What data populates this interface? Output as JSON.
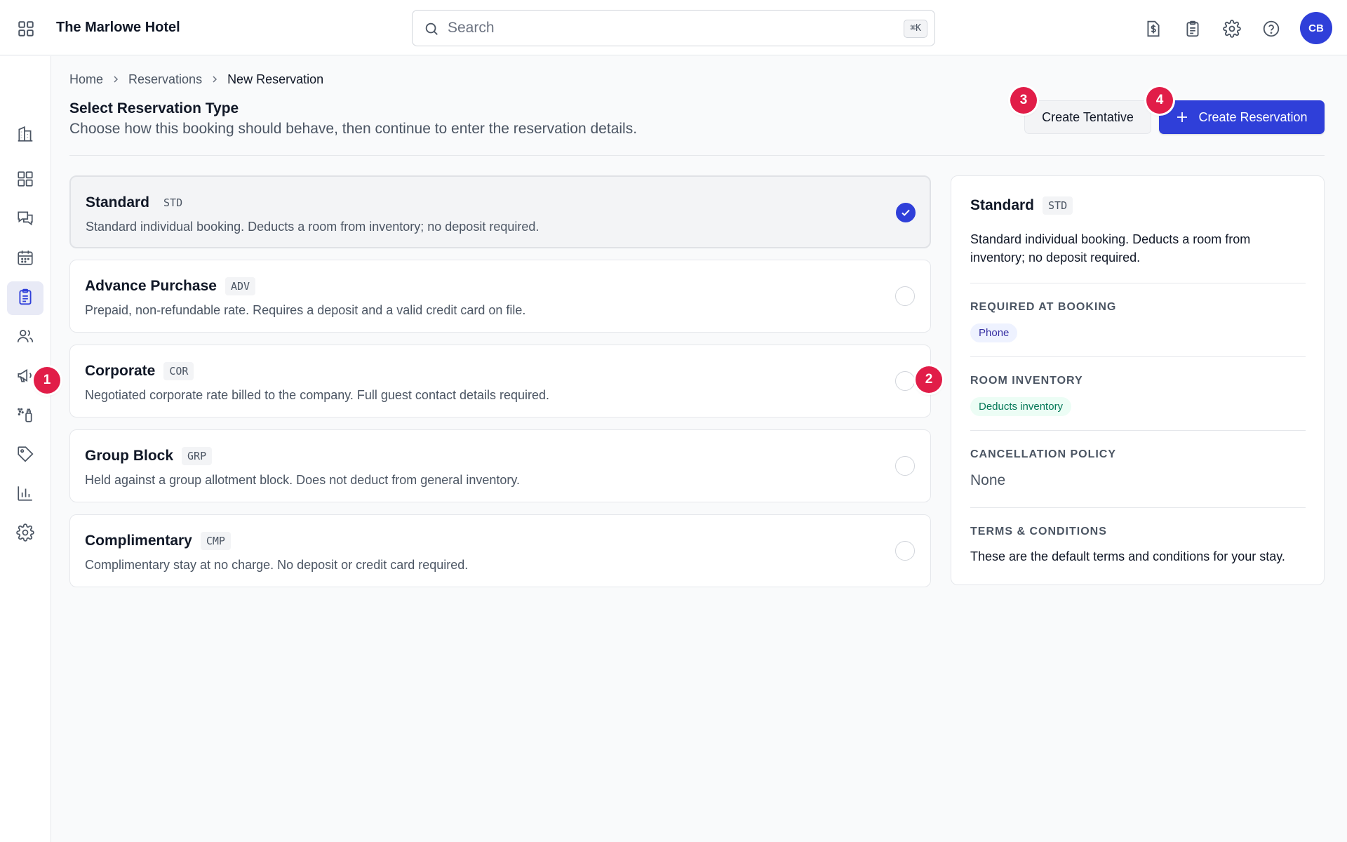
{
  "header": {
    "hotel_name": "The Marlowe Hotel",
    "search_placeholder": "Search",
    "search_shortcut": "⌘K",
    "avatar_initials": "CB",
    "icons": [
      "apps-grid-icon",
      "billing-icon",
      "clipboard-icon",
      "gear-icon",
      "help-icon"
    ]
  },
  "sidebar": {
    "items": [
      {
        "icon": "building-icon",
        "active": false
      },
      {
        "icon": "dashboard-icon",
        "active": false
      },
      {
        "icon": "messages-icon",
        "active": false
      },
      {
        "icon": "calendar-icon",
        "active": false
      },
      {
        "icon": "reservations-icon",
        "active": true
      },
      {
        "icon": "guests-icon",
        "active": false
      },
      {
        "icon": "megaphone-icon",
        "active": false
      },
      {
        "icon": "housekeeping-icon",
        "active": false
      },
      {
        "icon": "tag-icon",
        "active": false
      },
      {
        "icon": "reports-icon",
        "active": false
      },
      {
        "icon": "settings-icon",
        "active": false
      }
    ]
  },
  "breadcrumb": {
    "home": "Home",
    "reservations": "Reservations",
    "current": "New Reservation"
  },
  "page": {
    "title": "Select Reservation Type",
    "subtitle": "Choose how this booking should behave, then continue to enter the reservation details.",
    "tentative_button": "Create Tentative",
    "create_button": "Create Reservation"
  },
  "reservation_types": [
    {
      "name": "Standard",
      "code": "STD",
      "description": "Standard individual booking. Deducts a room from inventory; no deposit required.",
      "selected": true
    },
    {
      "name": "Advance Purchase",
      "code": "ADV",
      "description": "Prepaid, non-refundable rate. Requires a deposit and a valid credit card on file.",
      "selected": false
    },
    {
      "name": "Corporate",
      "code": "COR",
      "description": "Negotiated corporate rate billed to the company. Full guest contact details required.",
      "selected": false
    },
    {
      "name": "Group Block",
      "code": "GRP",
      "description": "Held against a group allotment block. Does not deduct from general inventory.",
      "selected": false
    },
    {
      "name": "Complimentary",
      "code": "CMP",
      "description": "Complimentary stay at no charge. No deposit or credit card required.",
      "selected": false
    }
  ],
  "detail": {
    "name": "Standard",
    "code": "STD",
    "description": "Standard individual booking. Deducts a room from inventory; no deposit required.",
    "required_label": "REQUIRED AT BOOKING",
    "required_value": "Phone",
    "inventory_label": "ROOM INVENTORY",
    "inventory_value": "Deducts inventory",
    "cancellation_label": "CANCELLATION POLICY",
    "cancellation_value": "None",
    "terms_label": "TERMS & CONDITIONS",
    "terms_value": "These are the default terms and conditions for your stay."
  },
  "markers": [
    "1",
    "2",
    "3",
    "4"
  ],
  "colors": {
    "accent": "#2f3fd9",
    "marker": "#e11d48",
    "active_nav": "#e8eaf6"
  }
}
